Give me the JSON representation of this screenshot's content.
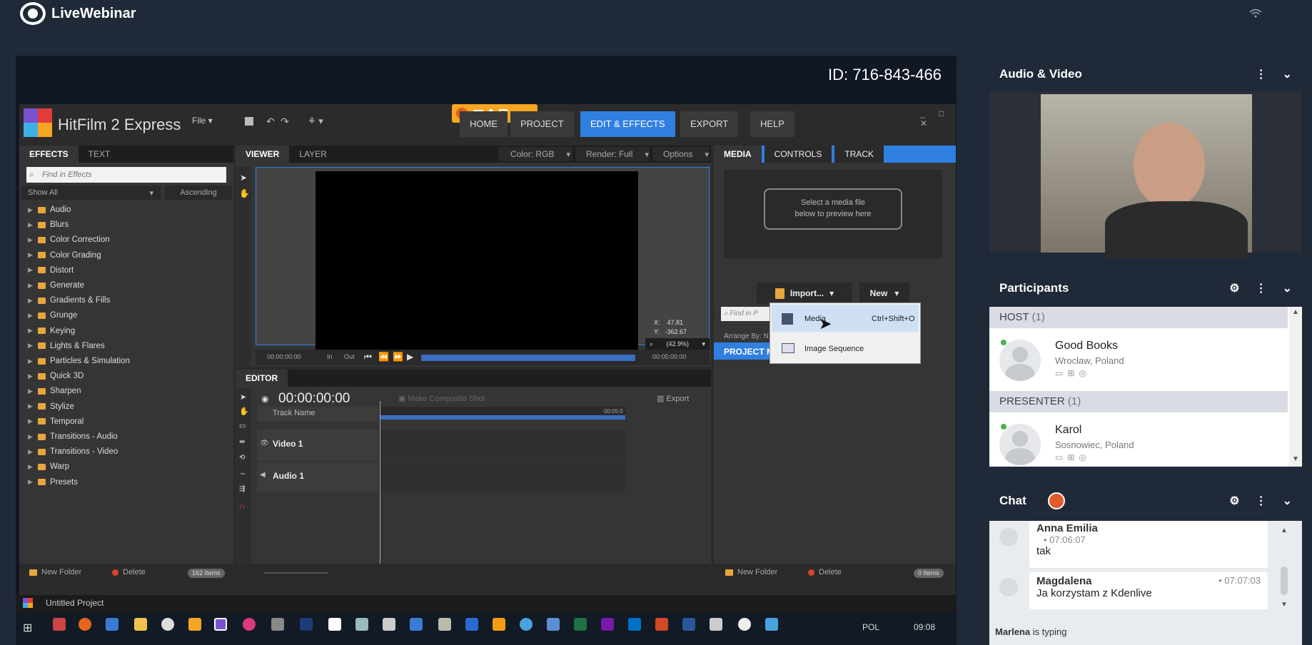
{
  "app": {
    "name": "LiveWebinar",
    "meeting_id": "ID: 716-843-466"
  },
  "hitfilm": {
    "title": "HitFilm 2 Express",
    "menu": {
      "file": "File"
    },
    "tabs": [
      "HOME",
      "PROJECT",
      "EDIT & EFFECTS",
      "EXPORT",
      "HELP"
    ],
    "active_tab": "EDIT & EFFECTS",
    "effects_panel": {
      "tabs": [
        "EFFECTS",
        "TEXT"
      ],
      "search_placeholder": "Find in Effects",
      "show": "Show All",
      "sort": "Ascending",
      "items": [
        "Audio",
        "Blurs",
        "Color Correction",
        "Color Grading",
        "Distort",
        "Generate",
        "Gradients & Fills",
        "Grunge",
        "Keying",
        "Lights & Flares",
        "Particles & Simulation",
        "Quick 3D",
        "Sharpen",
        "Stylize",
        "Temporal",
        "Transitions - Audio",
        "Transitions - Video",
        "Warp",
        "Presets"
      ],
      "new_folder": "New Folder",
      "delete": "Delete",
      "count": "162 Items"
    },
    "viewer": {
      "tabs": [
        "VIEWER",
        "LAYER"
      ],
      "color": "Color: RGB",
      "render": "Render: Full",
      "options": "Options",
      "x": "X:",
      "x_value": "47.81",
      "y": "Y:",
      "y_value": "-362.67",
      "zoom": "(42.9%)",
      "time_start": "00:00:00:00",
      "time_end": "00:05:00:00",
      "in": "In",
      "out": "Out"
    },
    "editor": {
      "title": "EDITOR",
      "timecode": "00:00:00:00",
      "composite": "Make Composite Shot",
      "export": "Export",
      "track_name": "Track Name",
      "end_marker": "00:05:0",
      "tracks": [
        "Video 1",
        "Audio 1"
      ]
    },
    "media_panel": {
      "tabs": [
        "MEDIA",
        "CONTROLS",
        "TRACK"
      ],
      "preview_hint_1": "Select a media file",
      "preview_hint_2": "below to preview here",
      "import": "Import...",
      "new": "New",
      "search_placeholder": "Find in P",
      "arrange": "Arrange By: N",
      "project_media": "PROJECT M",
      "new_folder": "New Folder",
      "delete": "Delete",
      "count": "0 Items",
      "dropdown": [
        {
          "label": "Media",
          "shortcut": "Ctrl+Shift+O"
        },
        {
          "label": "Image Sequence",
          "shortcut": ""
        }
      ]
    },
    "status_title": "Untitled Project"
  },
  "taskbar": {
    "lang": "POL",
    "time": "09:08"
  },
  "sidebar": {
    "audio_video": {
      "title": "Audio & Video"
    },
    "participants": {
      "title": "Participants",
      "groups": [
        {
          "label": "HOST",
          "count": "(1)",
          "people": [
            {
              "name": "Good Books",
              "location": "Wrocław, Poland"
            }
          ]
        },
        {
          "label": "PRESENTER",
          "count": "(1)",
          "people": [
            {
              "name": "Karol",
              "location": "Sosnowiec, Poland"
            }
          ]
        }
      ]
    },
    "chat": {
      "title": "Chat",
      "messages": [
        {
          "name": "Anna Emilia",
          "time": "07:06:07",
          "text": "tak"
        },
        {
          "name": "Magdalena",
          "time": "07:07:03",
          "text": "Ja korzystam z Kdenlive"
        }
      ],
      "typing_name": "Marlena",
      "typing_text": "is typing"
    }
  }
}
